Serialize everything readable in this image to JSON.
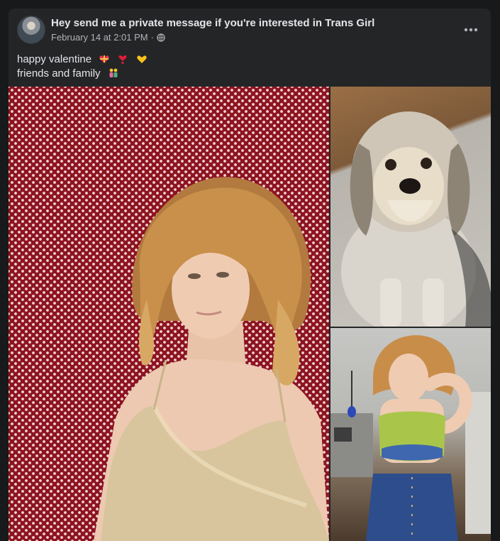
{
  "post": {
    "author": "Hey send me a private message if you're interested in Trans Girl",
    "timestamp": "February 14 at 2:01 PM",
    "separator": "·",
    "privacy_icon": "globe-icon",
    "more_icon": "more-dots-icon",
    "text_line1": "happy valentine",
    "text_line2": "friends and family",
    "line1_emojis": [
      "gift-heart-emoji",
      "heart-exclamation-emoji",
      "yellow-heart-emoji"
    ],
    "line2_emojis": [
      "family-emoji"
    ]
  },
  "photos": [
    {
      "name": "portrait-red-backdrop"
    },
    {
      "name": "dog-photo"
    },
    {
      "name": "mirror-selfie"
    }
  ],
  "colors": {
    "card_bg": "#242526",
    "page_bg": "#18191a",
    "text_primary": "#e4e6eb",
    "text_secondary": "#b0b3b8"
  }
}
